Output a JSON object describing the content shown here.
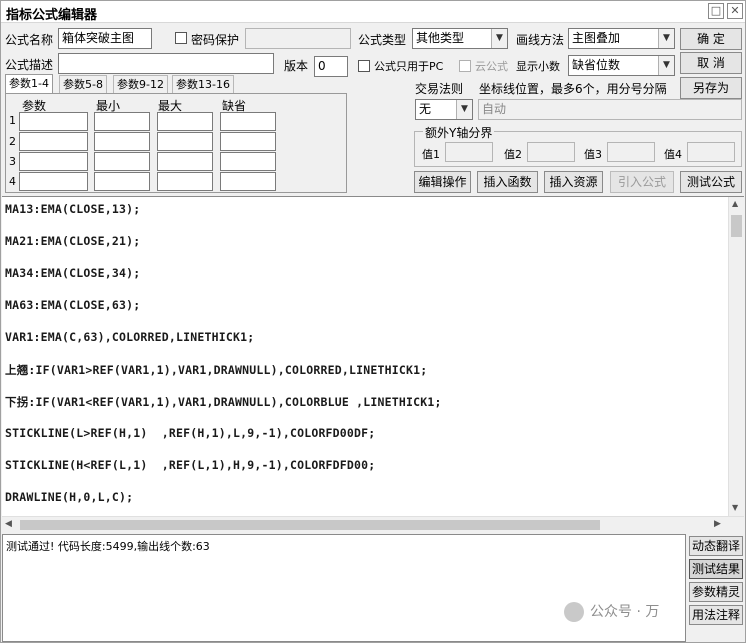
{
  "window": {
    "title": "指标公式编辑器"
  },
  "form": {
    "name_label": "公式名称",
    "name_value": "箱体突破主图",
    "password_label": "密码保护",
    "desc_label": "公式描述",
    "desc_value": "",
    "version_label": "版本",
    "version_value": "0",
    "type_label": "公式类型",
    "type_value": "其他类型",
    "draw_label": "画线方法",
    "draw_value": "主图叠加",
    "pc_only_label": "公式只用于PC",
    "cloud_label": "云公式",
    "decimals_label": "显示小数",
    "decimals_value": "缺省位数"
  },
  "buttons": {
    "ok": "确 定",
    "cancel": "取 消",
    "save_as": "另存为",
    "edit_ops": "编辑操作",
    "insert_func": "插入函数",
    "insert_res": "插入资源",
    "import_formula": "引入公式",
    "test_formula": "测试公式"
  },
  "param_tabs": [
    "参数1-4",
    "参数5-8",
    "参数9-12",
    "参数13-16"
  ],
  "param_headers": {
    "param": "参数",
    "min": "最小",
    "max": "最大",
    "default": "缺省"
  },
  "param_rows": [
    "1",
    "2",
    "3",
    "4"
  ],
  "trade": {
    "label": "交易法则",
    "value": "无",
    "coord_label": "坐标线位置，最多6个，用分号分隔",
    "coord_value": "自动"
  },
  "yaxis": {
    "title": "额外Y轴分界",
    "v1": "值1",
    "v2": "值2",
    "v3": "值3",
    "v4": "值4"
  },
  "code_lines": [
    "MA13:EMA(CLOSE,13);",
    "MA21:EMA(CLOSE,21);",
    "MA34:EMA(CLOSE,34);",
    "MA63:EMA(CLOSE,63);",
    "VAR1:EMA(C,63),COLORRED,LINETHICK1;",
    "上翘:IF(VAR1>REF(VAR1,1),VAR1,DRAWNULL),COLORRED,LINETHICK1;",
    "下拐:IF(VAR1<REF(VAR1,1),VAR1,DRAWNULL),COLORBLUE ,LINETHICK1;",
    "STICKLINE(L>REF(H,1)  ,REF(H,1),L,9,-1),COLORFD00DF;",
    "STICKLINE(H<REF(L,1)  ,REF(L,1),H,9,-1),COLORFDFD00;",
    "DRAWLINE(H,0,L,C);"
  ],
  "output": {
    "text": "测试通过! 代码长度:5499,输出线个数:63"
  },
  "side_buttons": [
    "动态翻译",
    "测试结果",
    "参数精灵",
    "用法注释"
  ],
  "watermark": "公众号 · 万"
}
